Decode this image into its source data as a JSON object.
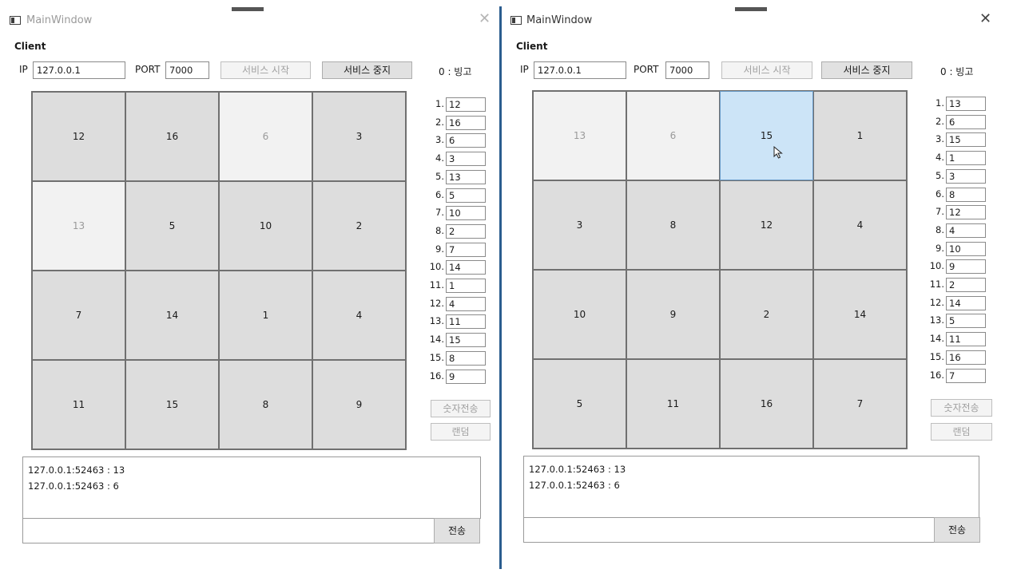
{
  "windows": [
    {
      "title": "MainWindow",
      "client_label": "Client",
      "ip_label": "IP",
      "ip_value": "127.0.0.1",
      "port_label": "PORT",
      "port_value": "7000",
      "start_button": "서비스 시작",
      "stop_button": "서비스 중지",
      "status": "0 : 빙고",
      "tiles": [
        {
          "label": "12",
          "state": "normal"
        },
        {
          "label": "16",
          "state": "normal"
        },
        {
          "label": "6",
          "state": "light"
        },
        {
          "label": "3",
          "state": "normal"
        },
        {
          "label": "13",
          "state": "light"
        },
        {
          "label": "5",
          "state": "normal"
        },
        {
          "label": "10",
          "state": "normal"
        },
        {
          "label": "2",
          "state": "normal"
        },
        {
          "label": "7",
          "state": "normal"
        },
        {
          "label": "14",
          "state": "normal"
        },
        {
          "label": "1",
          "state": "normal"
        },
        {
          "label": "4",
          "state": "normal"
        },
        {
          "label": "11",
          "state": "normal"
        },
        {
          "label": "15",
          "state": "normal"
        },
        {
          "label": "8",
          "state": "normal"
        },
        {
          "label": "9",
          "state": "normal"
        }
      ],
      "numbers": [
        {
          "label": "1.",
          "value": "12"
        },
        {
          "label": "2.",
          "value": "16"
        },
        {
          "label": "3.",
          "value": "6"
        },
        {
          "label": "4.",
          "value": "3"
        },
        {
          "label": "5.",
          "value": "13"
        },
        {
          "label": "6.",
          "value": "5"
        },
        {
          "label": "7.",
          "value": "10"
        },
        {
          "label": "8.",
          "value": "2"
        },
        {
          "label": "9.",
          "value": "7"
        },
        {
          "label": "10.",
          "value": "14"
        },
        {
          "label": "11.",
          "value": "1"
        },
        {
          "label": "12.",
          "value": "4"
        },
        {
          "label": "13.",
          "value": "11"
        },
        {
          "label": "14.",
          "value": "15"
        },
        {
          "label": "15.",
          "value": "8"
        },
        {
          "label": "16.",
          "value": "9"
        }
      ],
      "send_numbers_button": "숫자전송",
      "random_button": "랜덤",
      "log_lines": [
        "127.0.0.1:52463 : 13",
        "127.0.0.1:52463 : 6"
      ],
      "chat_input_value": "",
      "send_button": "전송"
    },
    {
      "title": "MainWindow",
      "client_label": "Client",
      "ip_label": "IP",
      "ip_value": "127.0.0.1",
      "port_label": "PORT",
      "port_value": "7000",
      "start_button": "서비스 시작",
      "stop_button": "서비스 중지",
      "status": "0 : 빙고",
      "tiles": [
        {
          "label": "13",
          "state": "light"
        },
        {
          "label": "6",
          "state": "light"
        },
        {
          "label": "15",
          "state": "selected"
        },
        {
          "label": "1",
          "state": "normal"
        },
        {
          "label": "3",
          "state": "normal"
        },
        {
          "label": "8",
          "state": "normal"
        },
        {
          "label": "12",
          "state": "normal"
        },
        {
          "label": "4",
          "state": "normal"
        },
        {
          "label": "10",
          "state": "normal"
        },
        {
          "label": "9",
          "state": "normal"
        },
        {
          "label": "2",
          "state": "normal"
        },
        {
          "label": "14",
          "state": "normal"
        },
        {
          "label": "5",
          "state": "normal"
        },
        {
          "label": "11",
          "state": "normal"
        },
        {
          "label": "16",
          "state": "normal"
        },
        {
          "label": "7",
          "state": "normal"
        }
      ],
      "numbers": [
        {
          "label": "1.",
          "value": "13"
        },
        {
          "label": "2.",
          "value": "6"
        },
        {
          "label": "3.",
          "value": "15"
        },
        {
          "label": "4.",
          "value": "1"
        },
        {
          "label": "5.",
          "value": "3"
        },
        {
          "label": "6.",
          "value": "8"
        },
        {
          "label": "7.",
          "value": "12"
        },
        {
          "label": "8.",
          "value": "4"
        },
        {
          "label": "9.",
          "value": "10"
        },
        {
          "label": "10.",
          "value": "9"
        },
        {
          "label": "11.",
          "value": "2"
        },
        {
          "label": "12.",
          "value": "14"
        },
        {
          "label": "13.",
          "value": "5"
        },
        {
          "label": "14.",
          "value": "11"
        },
        {
          "label": "15.",
          "value": "16"
        },
        {
          "label": "16.",
          "value": "7"
        }
      ],
      "send_numbers_button": "숫자전송",
      "random_button": "랜덤",
      "log_lines": [
        "127.0.0.1:52463 : 13",
        "127.0.0.1:52463 : 6"
      ],
      "chat_input_value": "",
      "send_button": "전송"
    }
  ],
  "icons": {
    "app_icon": "window-app-icon",
    "close_icon": "close-icon",
    "cursor_icon": "mouse-pointer-icon"
  },
  "colors": {
    "tile_normal": "#dddddd",
    "tile_light": "#f2f2f2",
    "tile_selected": "#cce4f7",
    "window_divider": "#2b5d8f"
  }
}
